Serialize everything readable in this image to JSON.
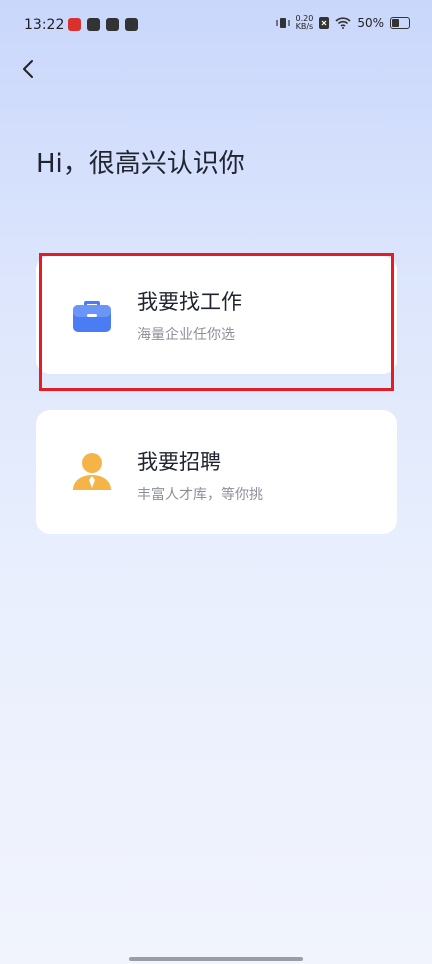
{
  "status_bar": {
    "time": "13:22",
    "net_speed_value": "0.20",
    "net_speed_unit": "KB/s",
    "battery_percent": "50%"
  },
  "greeting": "Hi，很高兴认识你",
  "options": [
    {
      "title": "我要找工作",
      "subtitle": "海量企业任你选",
      "icon": "briefcase-icon"
    },
    {
      "title": "我要招聘",
      "subtitle": "丰富人才库，等你挑",
      "icon": "recruiter-person-icon"
    }
  ],
  "colors": {
    "highlight": "#e41c24",
    "job_icon": "#4a7cf3",
    "hire_icon": "#f5b447"
  }
}
